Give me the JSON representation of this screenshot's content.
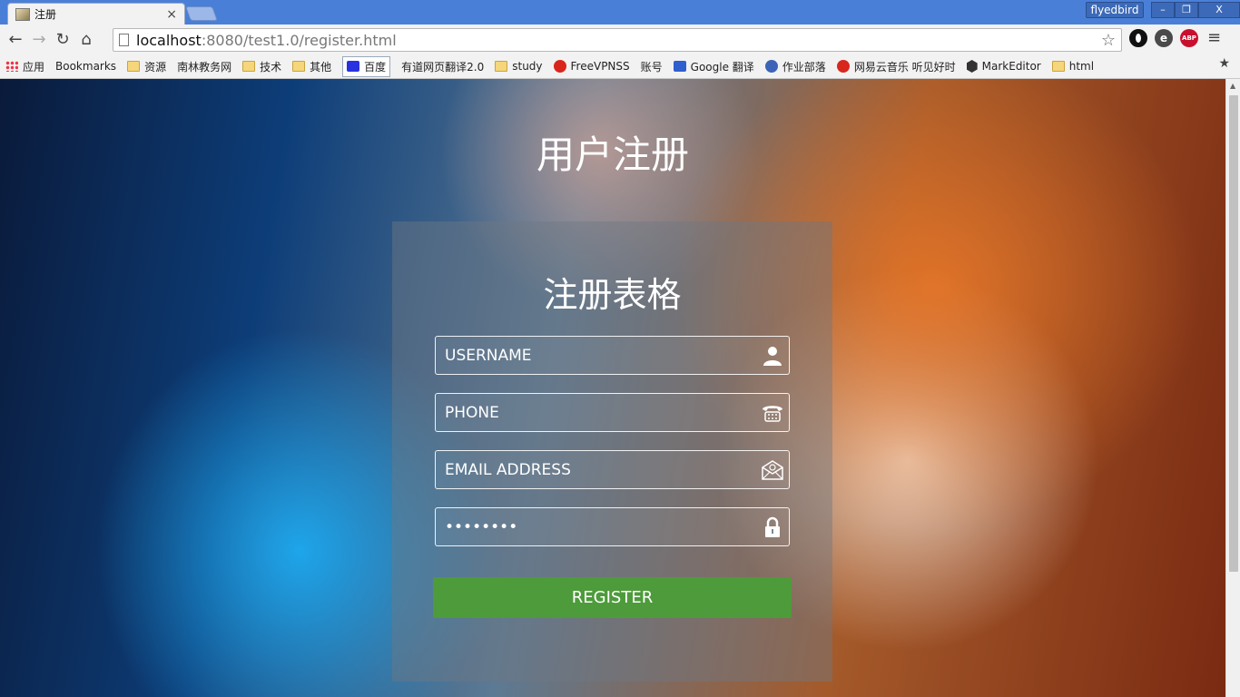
{
  "window": {
    "tab_title": "注册",
    "tab_close": "×",
    "profile_name": "flyedbird",
    "controls": {
      "minimize": "–",
      "restore": "❐",
      "close": "X"
    }
  },
  "toolbar": {
    "back": "←",
    "forward": "→",
    "reload": "↻",
    "home": "⌂",
    "url_host": "localhost",
    "url_rest": ":8080/test1.0/register.html",
    "star": "☆",
    "menu": "≡",
    "extensions": [
      {
        "name": "opera-icon",
        "label": ""
      },
      {
        "name": "e-icon",
        "label": "e"
      },
      {
        "name": "adblock-plus-icon",
        "label": "ABP"
      }
    ]
  },
  "bookmarks": [
    {
      "label": "应用",
      "icon": "apps"
    },
    {
      "label": "Bookmarks",
      "icon": "star"
    },
    {
      "label": "资源",
      "icon": "folder"
    },
    {
      "label": "南林教务网",
      "icon": "page"
    },
    {
      "label": "技术",
      "icon": "folder"
    },
    {
      "label": "其他",
      "icon": "folder"
    },
    {
      "label": "百度",
      "icon": "baidu"
    },
    {
      "label": "有道网页翻译2.0",
      "icon": "page"
    },
    {
      "label": "study",
      "icon": "folder"
    },
    {
      "label": "FreeVPNSS",
      "icon": "red"
    },
    {
      "label": "账号",
      "icon": "page"
    },
    {
      "label": "Google 翻译",
      "icon": "blue"
    },
    {
      "label": "作业部落",
      "icon": "round-blue"
    },
    {
      "label": "网易云音乐 听见好时",
      "icon": "red"
    },
    {
      "label": "MarkEditor",
      "icon": "hex"
    },
    {
      "label": "html",
      "icon": "folder"
    }
  ],
  "page": {
    "title": "用户注册",
    "form_title": "注册表格",
    "fields": {
      "username": {
        "placeholder": "USERNAME",
        "icon": "user-icon"
      },
      "phone": {
        "placeholder": "PHONE",
        "icon": "phone-icon"
      },
      "email": {
        "placeholder": "EMAIL ADDRESS",
        "icon": "email-icon"
      },
      "password": {
        "value": "••••••••",
        "icon": "lock-icon"
      }
    },
    "register_label": "REGISTER",
    "colors": {
      "register_button": "#4d9b3a",
      "background_orange": "#eb7828",
      "background_blue": "#1eaaf0"
    }
  }
}
